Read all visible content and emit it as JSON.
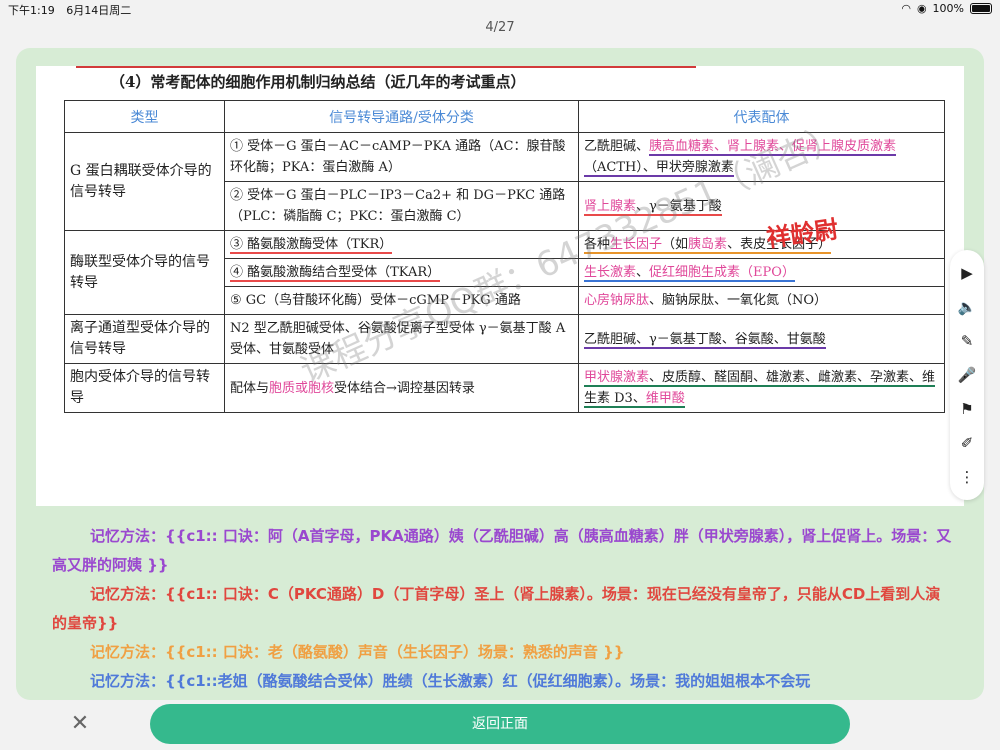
{
  "status": {
    "time": "下午1:19",
    "date": "6月14日周二",
    "battery": "100%"
  },
  "page_counter": "4/27",
  "scan": {
    "title": "（4）常考配体的细胞作用机制归纳总结（近几年的考试重点）",
    "headers": [
      "类型",
      "信号转导通路/受体分类",
      "代表配体"
    ],
    "rows": {
      "g1": {
        "type": "G 蛋白耦联受体介导的信号转导",
        "p1": "① 受体－G 蛋白－AC－cAMP－PKA 通路（AC：腺苷酸环化酶；PKA：蛋白激酶 A）",
        "l1a": "乙酰胆碱、",
        "l1b": "胰高血糖素、肾上腺素、促肾上腺皮质激素",
        "l1c": "（ACTH）、甲状旁腺激素",
        "p2": "② 受体－G 蛋白－PLC－IP3－Ca2+ 和 DG－PKC 通路（PLC：磷脂酶 C；PKC：蛋白激酶 C）",
        "l2a": "肾上腺素",
        "l2b": "、γ－氨基丁酸"
      },
      "e1": {
        "type": "酶联型受体介导的信号转导",
        "p1": "③ 酪氨酸激酶受体（TKR）",
        "l1a": "各种",
        "l1b": "生长因子",
        "l1c": "（如",
        "l1d": "胰岛素",
        "l1e": "、表皮生长因子）",
        "p2": "④ 酪氨酸激酶结合型受体（TKAR）",
        "l2a": "生长激素",
        "l2b": "、",
        "l2c": "促红细胞生成素",
        "l2d": "（EPO）",
        "p3": "⑤ GC（鸟苷酸环化酶）受体－cGMP－PKG 通路",
        "l3a": "心房钠尿肽",
        "l3b": "、脑钠尿肽、一氧化氮（NO）"
      },
      "i1": {
        "type": "离子通道型受体介导的信号转导",
        "p1": "N2 型乙酰胆碱受体、谷氨酸促离子型受体 γ－氨基丁酸 A 受体、甘氨酸受体",
        "l1": "乙酰胆碱、γ－氨基丁酸、谷氨酸、甘氨酸"
      },
      "n1": {
        "type": "胞内受体介导的信号转导",
        "p1a": "配体与",
        "p1b": "胞质或胞核",
        "p1c": "受体结合→调控基因转录",
        "l1a": "甲状腺激素",
        "l1b": "、皮质醇、醛固酮、雄激素、雌激素、孕激素、维生素 D3、",
        "l1c": "维甲酸"
      }
    },
    "handwriting": "祥龄尉",
    "watermark": "课程分享QQ群：647332851（澜杏）"
  },
  "notes": [
    "记忆方法：{{c1:: 口诀：阿（A首字母，PKA通路）姨（乙酰胆碱）高（胰高血糖素）胖（甲状旁腺素），肾上促肾上。场景：又高又胖的阿姨 }}",
    "记忆方法：{{c1:: 口诀：C（PKC通路）D（丁首字母）圣上（肾上腺素）。场景：现在已经没有皇帝了，只能从CD上看到人演的皇帝}}",
    "记忆方法：{{c1:: 口诀：老（酪氨酸）声音（生长因子）场景：熟悉的声音 }}",
    "记忆方法：{{c1::老姐（酪氨酸结合受体）胜绩（生长激素）红（促红细胞素）。场景：我的姐姐根本不会玩"
  ],
  "toolbar": {
    "icons": [
      "play-icon",
      "speaker-icon",
      "pencil-icon",
      "microphone-icon",
      "flag-icon",
      "brush-icon",
      "more-icon"
    ],
    "glyphs": [
      "▶",
      "🔈",
      "✎",
      "🎤",
      "⚑",
      "✐",
      "⋮"
    ]
  },
  "bottom": {
    "close": "✕",
    "back_label": "返回正面"
  },
  "colors": {
    "card_bg": "#d7ecd5",
    "back_button": "#35b98d",
    "note_purple": "#9a48cf",
    "note_red": "#e0473f",
    "note_orange": "#f0a043",
    "note_blue": "#4f79d9"
  }
}
